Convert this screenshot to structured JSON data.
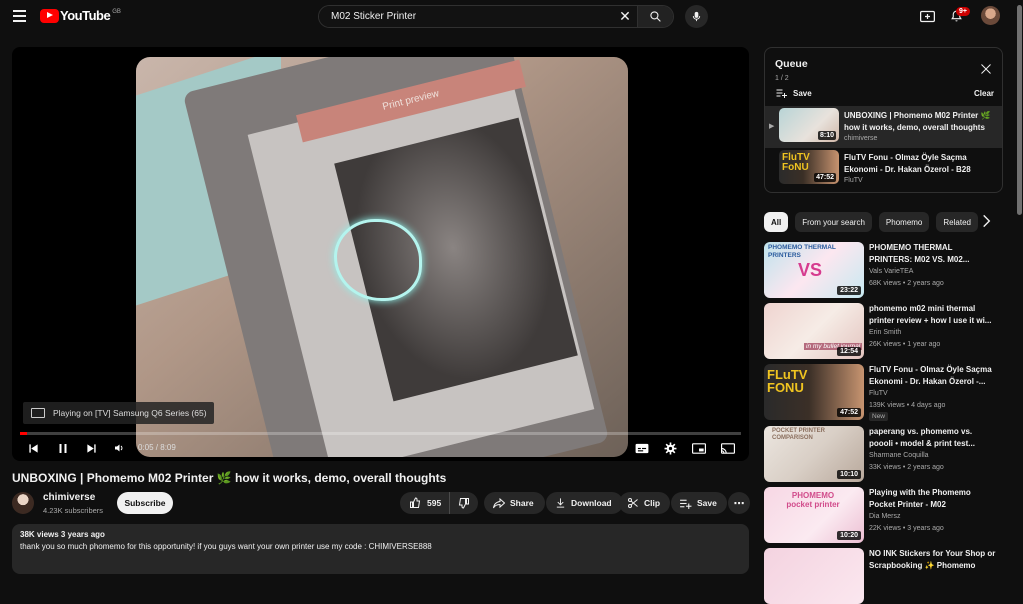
{
  "header": {
    "logo_text": "YouTube",
    "region": "GB",
    "search_value": "M02 Sticker Printer",
    "notification_count": "9+"
  },
  "player": {
    "cast_text": "Playing on [TV] Samsung Q6 Series (65)",
    "time": "0:05 / 8:09",
    "progress": 0.01,
    "preview_label": "Print preview"
  },
  "video": {
    "title": "UNBOXING | Phomemo M02 Printer 🌿 how it works, demo, overall thoughts",
    "channel": "chimiverse",
    "subscribers": "4.23K subscribers",
    "subscribe_label": "Subscribe",
    "likes": "595",
    "share_label": "Share",
    "download_label": "Download",
    "clip_label": "Clip",
    "save_label": "Save",
    "views_age": "38K views  3 years ago",
    "description": "thank you so much phomemo for this opportunity! if you guys want your own printer use my code : CHIMIVERSE888"
  },
  "queue": {
    "title": "Queue",
    "count": "1 / 2",
    "save_label": "Save",
    "clear_label": "Clear",
    "items": [
      {
        "title": "UNBOXING | Phomemo M02 Printer 🌿 how it works, demo, overall thoughts",
        "channel": "chimiverse",
        "duration": "8:10"
      },
      {
        "title": "FluTV Fonu - Olmaz Öyle Saçma Ekonomi - Dr. Hakan Özerol - B28",
        "channel": "FluTV",
        "duration": "47:52"
      }
    ]
  },
  "chips": [
    "All",
    "From your search",
    "Phomemo",
    "Related"
  ],
  "recommendations": [
    {
      "title": "PHOMEMO THERMAL PRINTERS: M02 VS. M02...",
      "channel": "Vals VarieTEA",
      "stats": "68K views • 2 years ago",
      "duration": "23:22",
      "thumb_text": "PHOMEMO THERMAL PRINTERS"
    },
    {
      "title": "phomemo m02 mini thermal printer review + how I use it wi...",
      "channel": "Erin Smith",
      "stats": "26K views • 1 year ago",
      "duration": "12:54",
      "thumb_text": "in my bullet journal"
    },
    {
      "title": "FluTV Fonu - Olmaz Öyle Saçma Ekonomi - Dr. Hakan Özerol -...",
      "channel": "FluTV",
      "stats": "139K views • 4 days ago",
      "duration": "47:52",
      "badge": "New",
      "thumb_text": "FLuTV FONU"
    },
    {
      "title": "paperang vs. phomemo vs. poooli • model & print test...",
      "channel": "Sharmane Coquilla",
      "stats": "33K views • 2 years ago",
      "duration": "10:10",
      "thumb_text": "POCKET PRINTER COMPARISON"
    },
    {
      "title": "Playing with the Phomemo Pocket Printer - M02",
      "channel": "Dia Mersz",
      "stats": "22K views • 3 years ago",
      "duration": "10:20",
      "thumb_text": "PHOMEMO pocket printer"
    },
    {
      "title": "NO INK Stickers for Your Shop or Scrapbooking ✨ Phomemo",
      "channel": "",
      "stats": "",
      "duration": "",
      "thumb_text": ""
    }
  ],
  "colors": {
    "accent": "#ff0000",
    "background": "#0f0f0f",
    "surface": "#272727"
  }
}
